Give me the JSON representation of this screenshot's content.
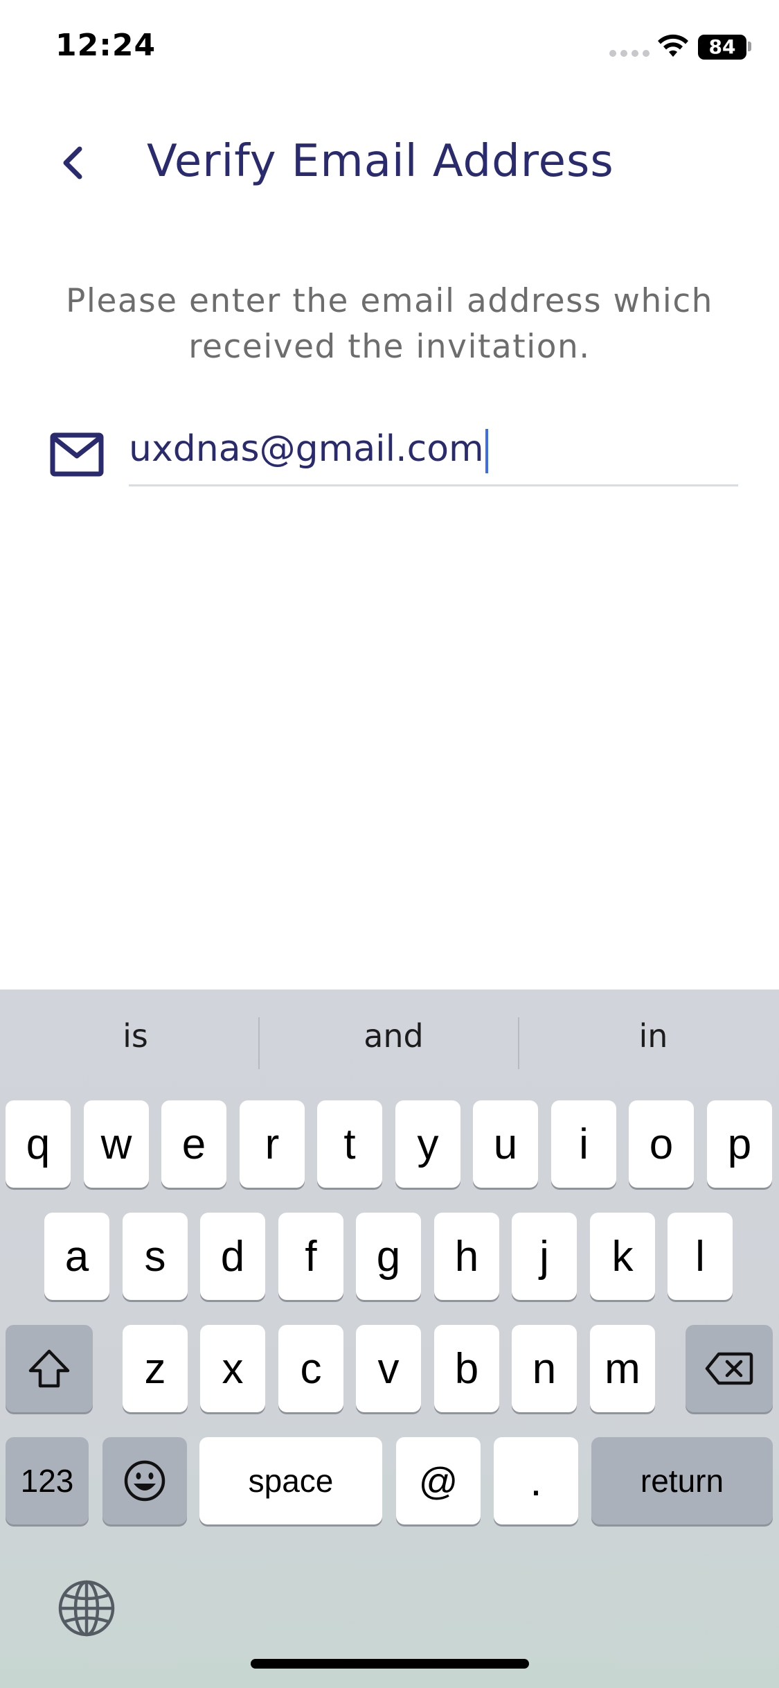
{
  "status_bar": {
    "time": "12:24",
    "battery": "84",
    "icons": [
      "cellular-signal-icon",
      "wifi-icon",
      "battery-icon"
    ]
  },
  "header": {
    "back_icon": "chevron-left-icon",
    "title": "Verify Email Address"
  },
  "instruction": "Please enter the email address which received the invitation.",
  "email_field": {
    "icon": "mail-icon",
    "value": "uxdnas@gmail.com"
  },
  "keyboard": {
    "suggestions": [
      "is",
      "and",
      "in"
    ],
    "row1": [
      "q",
      "w",
      "e",
      "r",
      "t",
      "y",
      "u",
      "i",
      "o",
      "p"
    ],
    "row2": [
      "a",
      "s",
      "d",
      "f",
      "g",
      "h",
      "j",
      "k",
      "l"
    ],
    "row3": [
      "z",
      "x",
      "c",
      "v",
      "b",
      "n",
      "m"
    ],
    "numbers_label": "123",
    "space_label": "space",
    "at_label": "@",
    "dot_label": ".",
    "return_label": "return",
    "icons": [
      "shift-icon",
      "backspace-icon",
      "emoji-icon",
      "globe-icon"
    ]
  },
  "colors": {
    "title": "#2a2a6e",
    "caret": "#3b6cf0",
    "instruction": "#6d6d6d",
    "keyboard_bg": "#d1d4da"
  }
}
